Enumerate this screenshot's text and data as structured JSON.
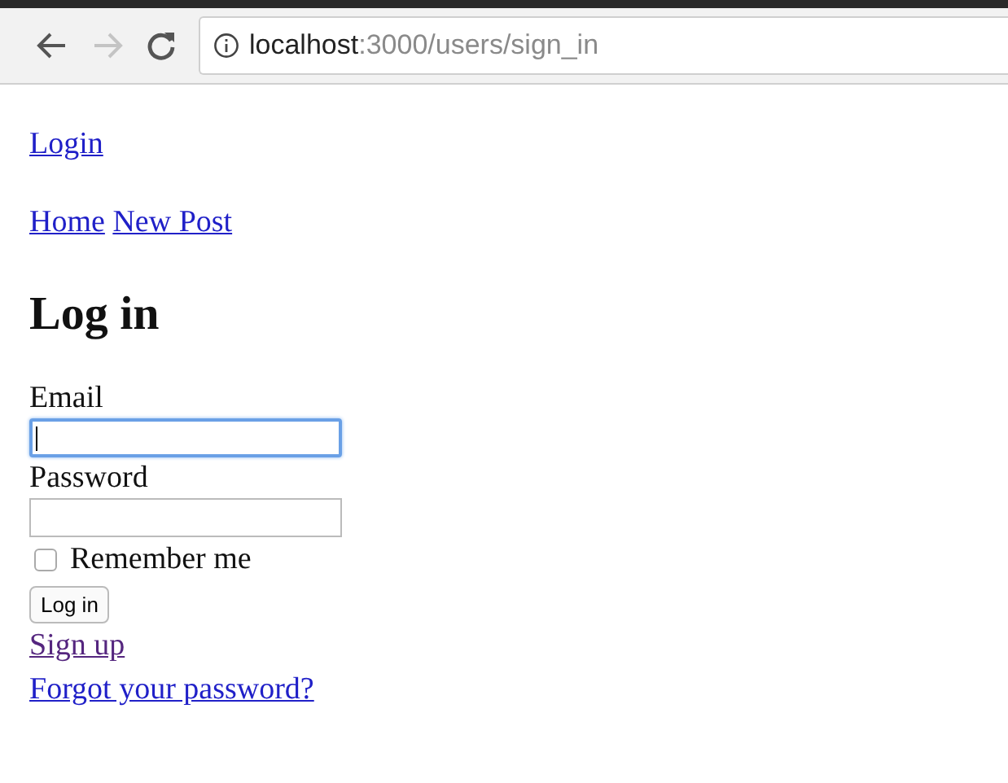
{
  "toolbar": {
    "back": {
      "disabled": false
    },
    "forward": {
      "disabled": true
    },
    "address": "**localhost**:3000/users/sign_in"
  },
  "nav_top": [
    {
      "label": "Login",
      "visited": false
    }
  ],
  "nav": [
    {
      "label": "Home",
      "visited": false
    },
    {
      "label": "New Post",
      "visited": false
    }
  ],
  "heading": "Log in",
  "fields": [
    {
      "label": "Email",
      "focused": true
    },
    {
      "label": "Password",
      "focused": false
    }
  ],
  "remember": {
    "label": "Remember me",
    "checked": false
  },
  "submit": "Log in",
  "links": [
    {
      "label": "Sign up",
      "visited": true
    },
    {
      "label": "Forgot your password?",
      "visited": false
    }
  ]
}
